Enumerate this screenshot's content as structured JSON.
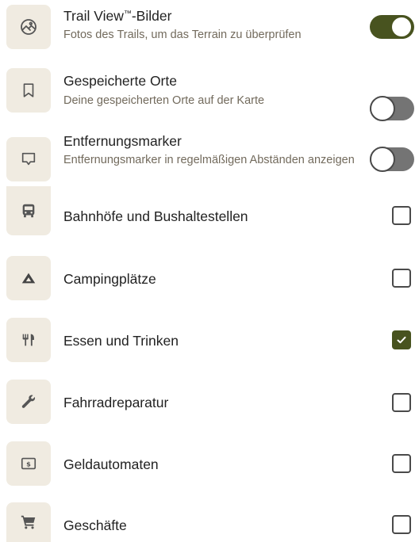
{
  "colors": {
    "accent": "#48531f",
    "icon_background": "#f0ebe1",
    "subtitle": "#726a5c"
  },
  "toggle_rows": [
    {
      "icon": "image-gallery-icon",
      "title": "Trail View",
      "title_sup": "™",
      "title_suffix": "-Bilder",
      "subtitle": "Fotos des Trails, um das Terrain zu überprüfen",
      "enabled": true
    },
    {
      "icon": "bookmark-icon",
      "title": "Gespeicherte Orte",
      "subtitle": "Deine gespeicherten Orte auf der Karte",
      "enabled": false
    },
    {
      "icon": "distance-marker-icon",
      "title": "Entfernungsmarker",
      "subtitle": "Entfernungsmarker in regelmäßigen Abständen anzeigen",
      "enabled": false
    }
  ],
  "checkbox_rows": [
    {
      "icon": "bus-icon",
      "label": "Bahnhöfe und Bushaltestellen",
      "checked": false
    },
    {
      "icon": "tent-icon",
      "label": "Campingplätze",
      "checked": false
    },
    {
      "icon": "fork-knife-icon",
      "label": "Essen und Trinken",
      "checked": true
    },
    {
      "icon": "wrench-icon",
      "label": "Fahrradreparatur",
      "checked": false
    },
    {
      "icon": "atm-icon",
      "label": "Geldautomaten",
      "checked": false
    },
    {
      "icon": "shopping-cart-icon",
      "label": "Geschäfte",
      "checked": false
    }
  ]
}
